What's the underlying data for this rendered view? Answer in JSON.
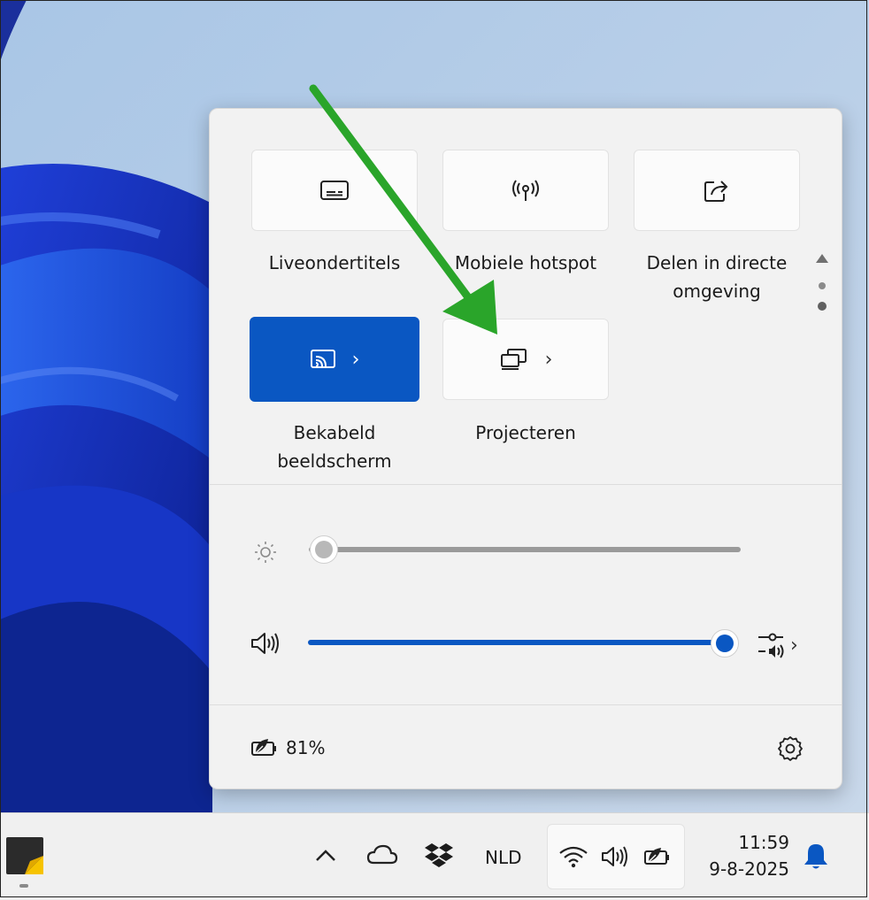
{
  "quick_settings": {
    "tiles": [
      {
        "label": "Liveondertitels",
        "icon": "captions-icon",
        "active": false,
        "has_chevron": false
      },
      {
        "label": "Mobiele hotspot",
        "icon": "hotspot-icon",
        "active": false,
        "has_chevron": false
      },
      {
        "label_line1": "Delen in directe",
        "label_line2": "omgeving",
        "icon": "share-icon",
        "active": false,
        "has_chevron": false
      },
      {
        "label_line1": "Bekabeld",
        "label_line2": "beeldscherm",
        "icon": "cast-icon",
        "active": true,
        "has_chevron": true
      },
      {
        "label": "Projecteren",
        "icon": "project-icon",
        "active": false,
        "has_chevron": true
      }
    ],
    "chevron": "›",
    "brightness": {
      "icon": "brightness-icon",
      "level": 0
    },
    "volume": {
      "icon": "speaker-icon",
      "level": 1.0,
      "mixer_icon": "volume-mixer-icon"
    },
    "battery": {
      "icon": "battery-saver-icon",
      "text": "81%"
    },
    "settings_icon": "gear-icon",
    "page_indicator": {
      "pages": 2,
      "current": 1
    }
  },
  "taskbar": {
    "overflow_icon": "chevron-up-icon",
    "language": "NLD",
    "time": "11:59",
    "date": "9-8-2025"
  },
  "annotation": {
    "arrow_color": "#2aa52a",
    "points_to": "Projecteren"
  },
  "colors": {
    "accent": "#0a57c2",
    "panel_bg": "#f2f2f2"
  }
}
